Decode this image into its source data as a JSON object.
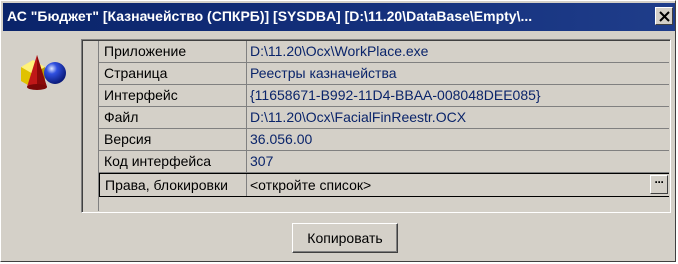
{
  "window": {
    "title": "АС \"Бюджет\" [Казначейство (СПКРБ)] [SYSDBA] [D:\\11.20\\DataBase\\Empty\\...",
    "close_icon": "close-icon"
  },
  "app_icon": "shapes-icon",
  "properties": [
    {
      "name": "Приложение",
      "value": "D:\\11.20\\Ocx\\WorkPlace.exe"
    },
    {
      "name": "Страница",
      "value": "Реестры казначейства"
    },
    {
      "name": "Интерфейс",
      "value": "{11658671-B992-11D4-BBAA-008048DEE085}"
    },
    {
      "name": "Файл",
      "value": "D:\\11.20\\Ocx\\FacialFinReestr.OCX"
    },
    {
      "name": "Версия",
      "value": "36.056.00"
    },
    {
      "name": "Код интерфейса",
      "value": "307"
    },
    {
      "name": "Права, блокировки",
      "value": "<откройте список>"
    }
  ],
  "ellipsis_label": "···",
  "copy_button_label": "Копировать",
  "colors": {
    "titlebar": "#0a246a",
    "dialog_face": "#d4d0c8",
    "value_text": "#0a246a"
  }
}
